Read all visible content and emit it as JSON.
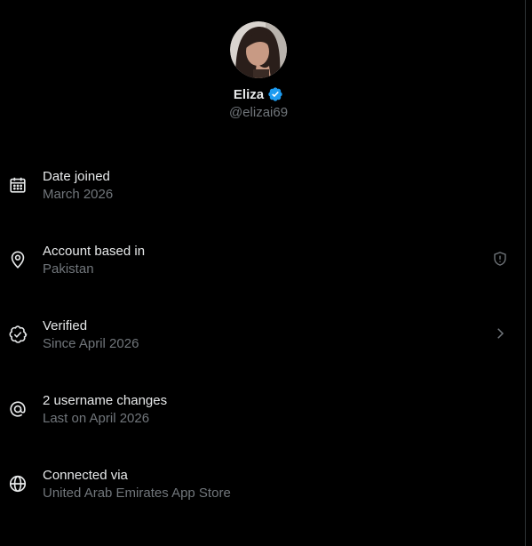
{
  "profile": {
    "display_name": "Eliza",
    "handle": "@elizai69",
    "avatar_icon": "user-avatar-photo",
    "verified_icon": "verified-badge-icon",
    "verified_color": "#1d9bf0"
  },
  "info": [
    {
      "icon": "calendar-icon",
      "title": "Date joined",
      "subtitle": "March 2026"
    },
    {
      "icon": "location-pin-icon",
      "title": "Account based in",
      "subtitle": "Pakistan",
      "trailing_icon": "shield-alert-icon"
    },
    {
      "icon": "verified-check-icon",
      "title": "Verified",
      "subtitle": "Since April 2026",
      "trailing_icon": "chevron-right-icon"
    },
    {
      "icon": "at-sign-icon",
      "title": "2 username changes",
      "subtitle": "Last on April 2026"
    },
    {
      "icon": "globe-icon",
      "title": "Connected via",
      "subtitle": "United Arab Emirates App Store"
    }
  ],
  "colors": {
    "background": "#000000",
    "primary_text": "#e7e9ea",
    "secondary_text": "#71767b"
  }
}
